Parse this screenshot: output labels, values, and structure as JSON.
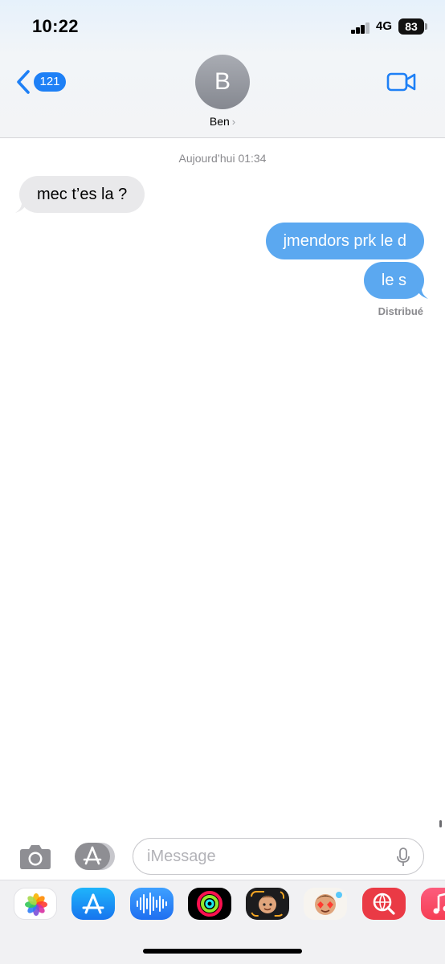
{
  "status_bar": {
    "time": "10:22",
    "network": "4G",
    "battery": "83"
  },
  "nav": {
    "back_count": "121",
    "contact_initial": "B",
    "contact_name": "Ben",
    "contact_chevron": "›"
  },
  "conversation": {
    "timestamp": "Aujourd’hui 01:34",
    "messages": [
      {
        "direction": "received",
        "text": "mec t’es la ?"
      },
      {
        "direction": "sent",
        "text": "jmendors prk le d"
      },
      {
        "direction": "sent",
        "text": "le s"
      }
    ],
    "delivery_status": "Distribué"
  },
  "composer": {
    "placeholder": "iMessage"
  },
  "icons": {
    "back": "chevron-left-icon",
    "video": "video-camera-icon",
    "camera": "camera-icon",
    "apps": "app-store-icon",
    "mic": "microphone-icon"
  },
  "app_drawer": [
    "Photos",
    "App Store",
    "Audio",
    "Activity",
    "Memoji",
    "Memoji Stickers",
    "Images",
    "Music"
  ],
  "colors": {
    "accent": "#1e80f6",
    "sent_bubble": "#5ba8f0",
    "received_bubble": "#e9e9eb",
    "secondary_text": "#8a8a8e"
  }
}
